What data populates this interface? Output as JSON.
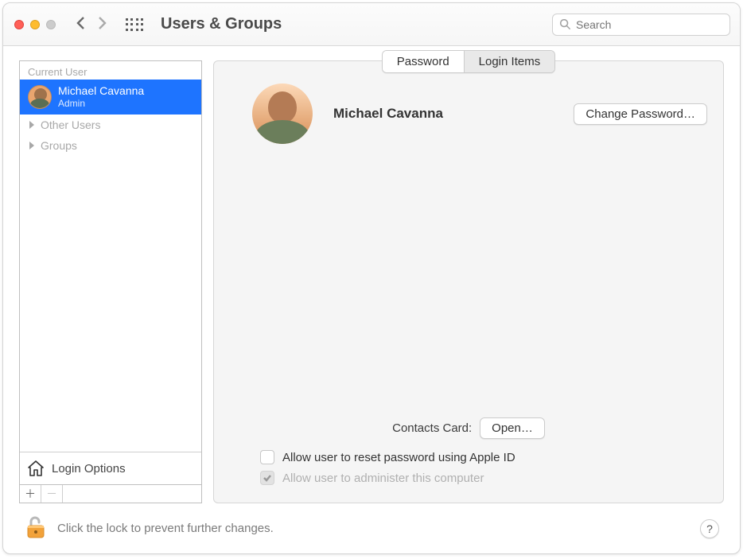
{
  "toolbar": {
    "title": "Users & Groups",
    "search_placeholder": "Search"
  },
  "sidebar": {
    "current_user_header": "Current User",
    "user": {
      "name": "Michael Cavanna",
      "role": "Admin"
    },
    "categories": {
      "other_users": "Other Users",
      "groups": "Groups"
    },
    "login_options_label": "Login Options"
  },
  "tabs": {
    "password": "Password",
    "login_items": "Login Items"
  },
  "content": {
    "full_name": "Michael Cavanna",
    "change_password_label": "Change Password…",
    "contacts_card_label": "Contacts Card:",
    "open_label": "Open…",
    "checkbox1_label": "Allow user to reset password using Apple ID",
    "checkbox2_label": "Allow user to administer this computer"
  },
  "footer": {
    "text": "Click the lock to prevent further changes."
  }
}
